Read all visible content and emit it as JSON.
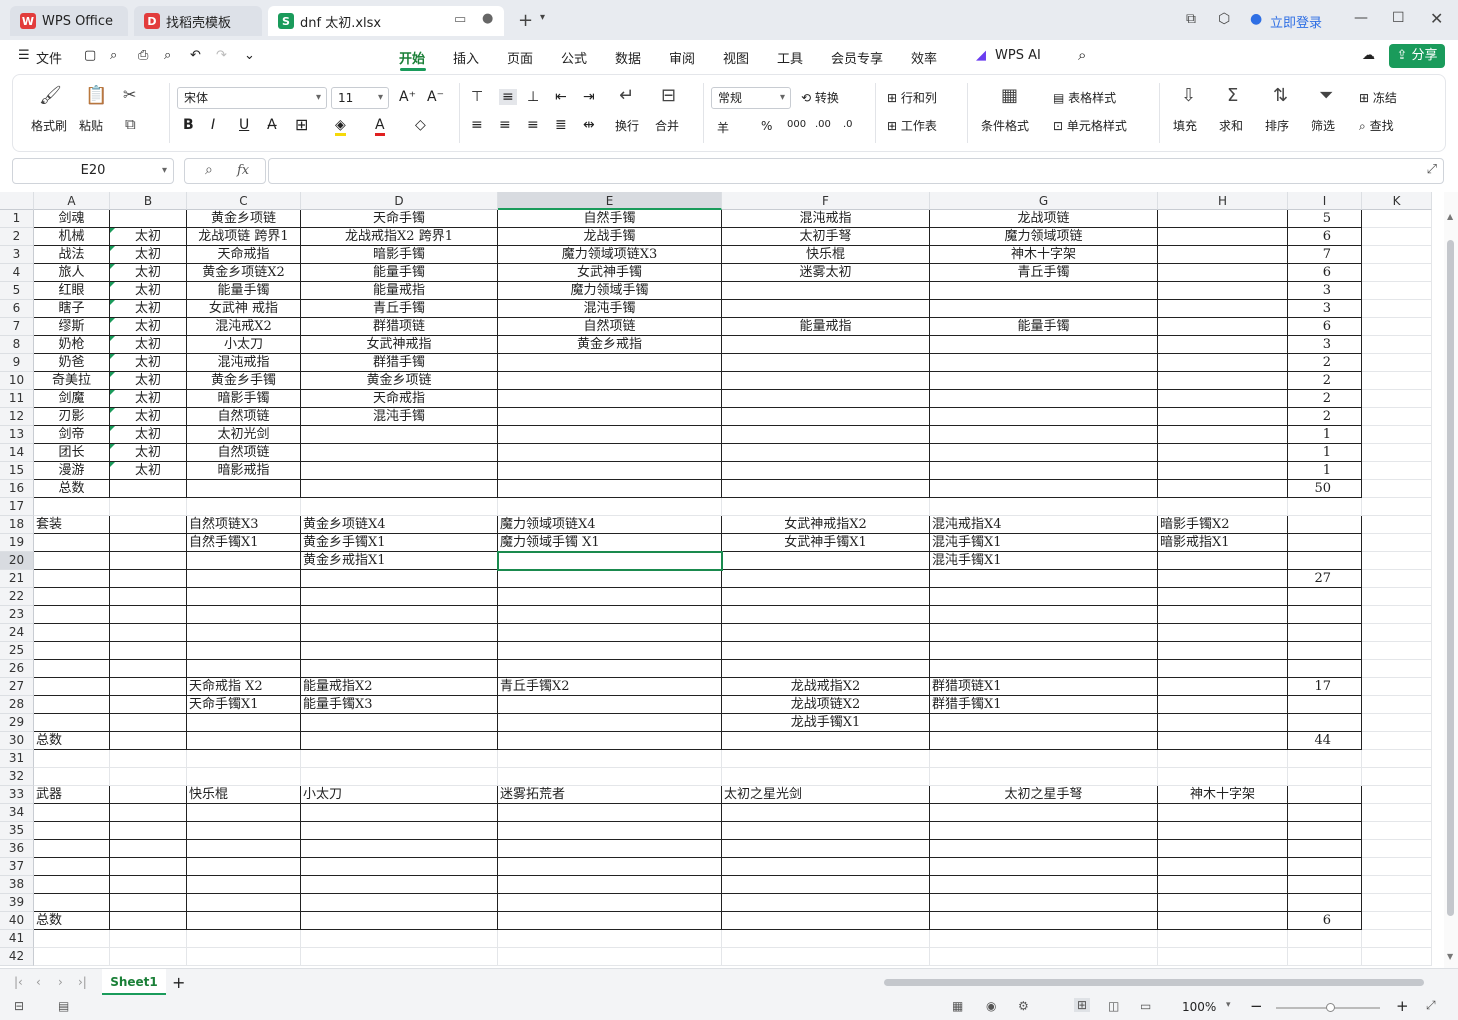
{
  "tabs": [
    {
      "label": "WPS Office"
    },
    {
      "label": "找稻壳模板"
    },
    {
      "label": "dnf 太初.xlsx"
    }
  ],
  "window": {
    "login": "立即登录",
    "share": "分享"
  },
  "menu": {
    "file": "文件",
    "items": [
      "开始",
      "插入",
      "页面",
      "公式",
      "数据",
      "审阅",
      "视图",
      "工具",
      "会员专享",
      "效率"
    ],
    "ai": "WPS AI",
    "active": "开始"
  },
  "ribbon": {
    "format_painter": "格式刷",
    "paste": "粘贴",
    "font": "宋体",
    "size": "11",
    "wrap": "换行",
    "merge": "合并",
    "number_format": "常规",
    "convert": "转换",
    "rowcol": "行和列",
    "worksheet": "工作表",
    "cond_format": "条件格式",
    "table_style": "表格样式",
    "cell_style": "单元格样式",
    "fill": "填充",
    "sum": "求和",
    "sort": "排序",
    "filter": "筛选",
    "freeze": "冻结",
    "find": "查找",
    "bold": "B",
    "italic": "I",
    "underline": "U",
    "currency": "羊",
    "percent": "%"
  },
  "formula": {
    "name_box": "E20",
    "fx": "fx",
    "value": ""
  },
  "columns": [
    "A",
    "B",
    "C",
    "D",
    "E",
    "F",
    "G",
    "H",
    "I",
    "K"
  ],
  "selected_cell": "E20",
  "rows": {
    "1": [
      "剑魂",
      "",
      "黄金乡项链",
      "天命手镯",
      "自然手镯",
      "混沌戒指",
      "龙战项链",
      "",
      "5"
    ],
    "2": [
      "机械",
      "太初",
      "龙战项链 跨界1",
      "龙战戒指X2 跨界1",
      "龙战手镯",
      "太初手弩",
      "魔力领域项链",
      "",
      "6"
    ],
    "3": [
      "战法",
      "太初",
      "天命戒指",
      "暗影手镯",
      "魔力领域项链X3",
      "快乐棍",
      "神木十字架",
      "",
      "7"
    ],
    "4": [
      "旅人",
      "太初",
      "黄金乡项链X2",
      "能量手镯",
      "女武神手镯",
      "迷雾太初",
      "青丘手镯",
      "",
      "6"
    ],
    "5": [
      "红眼",
      "太初",
      "能量手镯",
      "能量戒指",
      "魔力领域手镯",
      "",
      "",
      "",
      "3"
    ],
    "6": [
      "瞎子",
      "太初",
      "女武神 戒指",
      "青丘手镯",
      "混沌手镯",
      "",
      "",
      "",
      "3"
    ],
    "7": [
      "缪斯",
      "太初",
      "混沌戒X2",
      "群猎项链",
      "自然项链",
      "能量戒指",
      "能量手镯",
      "",
      "6"
    ],
    "8": [
      "奶枪",
      "太初",
      "小太刀",
      "女武神戒指",
      "黄金乡戒指",
      "",
      "",
      "",
      "3"
    ],
    "9": [
      "奶爸",
      "太初",
      "混沌戒指",
      "群猎手镯",
      "",
      "",
      "",
      "",
      "2"
    ],
    "10": [
      "奇美拉",
      "太初",
      "黄金乡手镯",
      "黄金乡项链",
      "",
      "",
      "",
      "",
      "2"
    ],
    "11": [
      "剑魔",
      "太初",
      "暗影手镯",
      "天命戒指",
      "",
      "",
      "",
      "",
      "2"
    ],
    "12": [
      "刃影",
      "太初",
      "自然项链",
      "混沌手镯",
      "",
      "",
      "",
      "",
      "2"
    ],
    "13": [
      "剑帝",
      "太初",
      "太初光剑",
      "",
      "",
      "",
      "",
      "",
      "1"
    ],
    "14": [
      "团长",
      "太初",
      "自然项链",
      "",
      "",
      "",
      "",
      "",
      "1"
    ],
    "15": [
      "漫游",
      "太初",
      "暗影戒指",
      "",
      "",
      "",
      "",
      "",
      "1"
    ],
    "16": [
      "总数",
      "",
      "",
      "",
      "",
      "",
      "",
      "",
      "50"
    ],
    "18": [
      "套装",
      "",
      "自然项链X3",
      "黄金乡项链X4",
      "魔力领域项链X4",
      "女武神戒指X2",
      "混沌戒指X4",
      "暗影手镯X2",
      ""
    ],
    "19": [
      "",
      "",
      "自然手镯X1",
      "黄金乡手镯X1",
      "魔力领域手镯 X1",
      "女武神手镯X1",
      "混沌手镯X1",
      "暗影戒指X1",
      ""
    ],
    "20": [
      "",
      "",
      "",
      "黄金乡戒指X1",
      "",
      "",
      "混沌手镯X1",
      "",
      ""
    ],
    "21": [
      "",
      "",
      "",
      "",
      "",
      "",
      "",
      "",
      "27"
    ],
    "27": [
      "",
      "",
      "天命戒指 X2",
      "能量戒指X2",
      "青丘手镯X2",
      "龙战戒指X2",
      "群猎项链X1",
      "",
      "17"
    ],
    "28": [
      "",
      "",
      "天命手镯X1",
      "能量手镯X3",
      "",
      "龙战项链X2",
      "群猎手镯X1",
      "",
      ""
    ],
    "29": [
      "",
      "",
      "",
      "",
      "",
      "龙战手镯X1",
      "",
      "",
      ""
    ],
    "30": [
      "总数",
      "",
      "",
      "",
      "",
      "",
      "",
      "",
      "44"
    ],
    "33": [
      "武器",
      "",
      "快乐棍",
      "小太刀",
      "迷雾拓荒者",
      "太初之星光剑",
      "太初之星手弩",
      "神木十字架",
      ""
    ],
    "40": [
      "总数",
      "",
      "",
      "",
      "",
      "",
      "",
      "",
      "6"
    ]
  },
  "sheets": [
    {
      "name": "Sheet1"
    }
  ],
  "status": {
    "zoom": "100%"
  }
}
